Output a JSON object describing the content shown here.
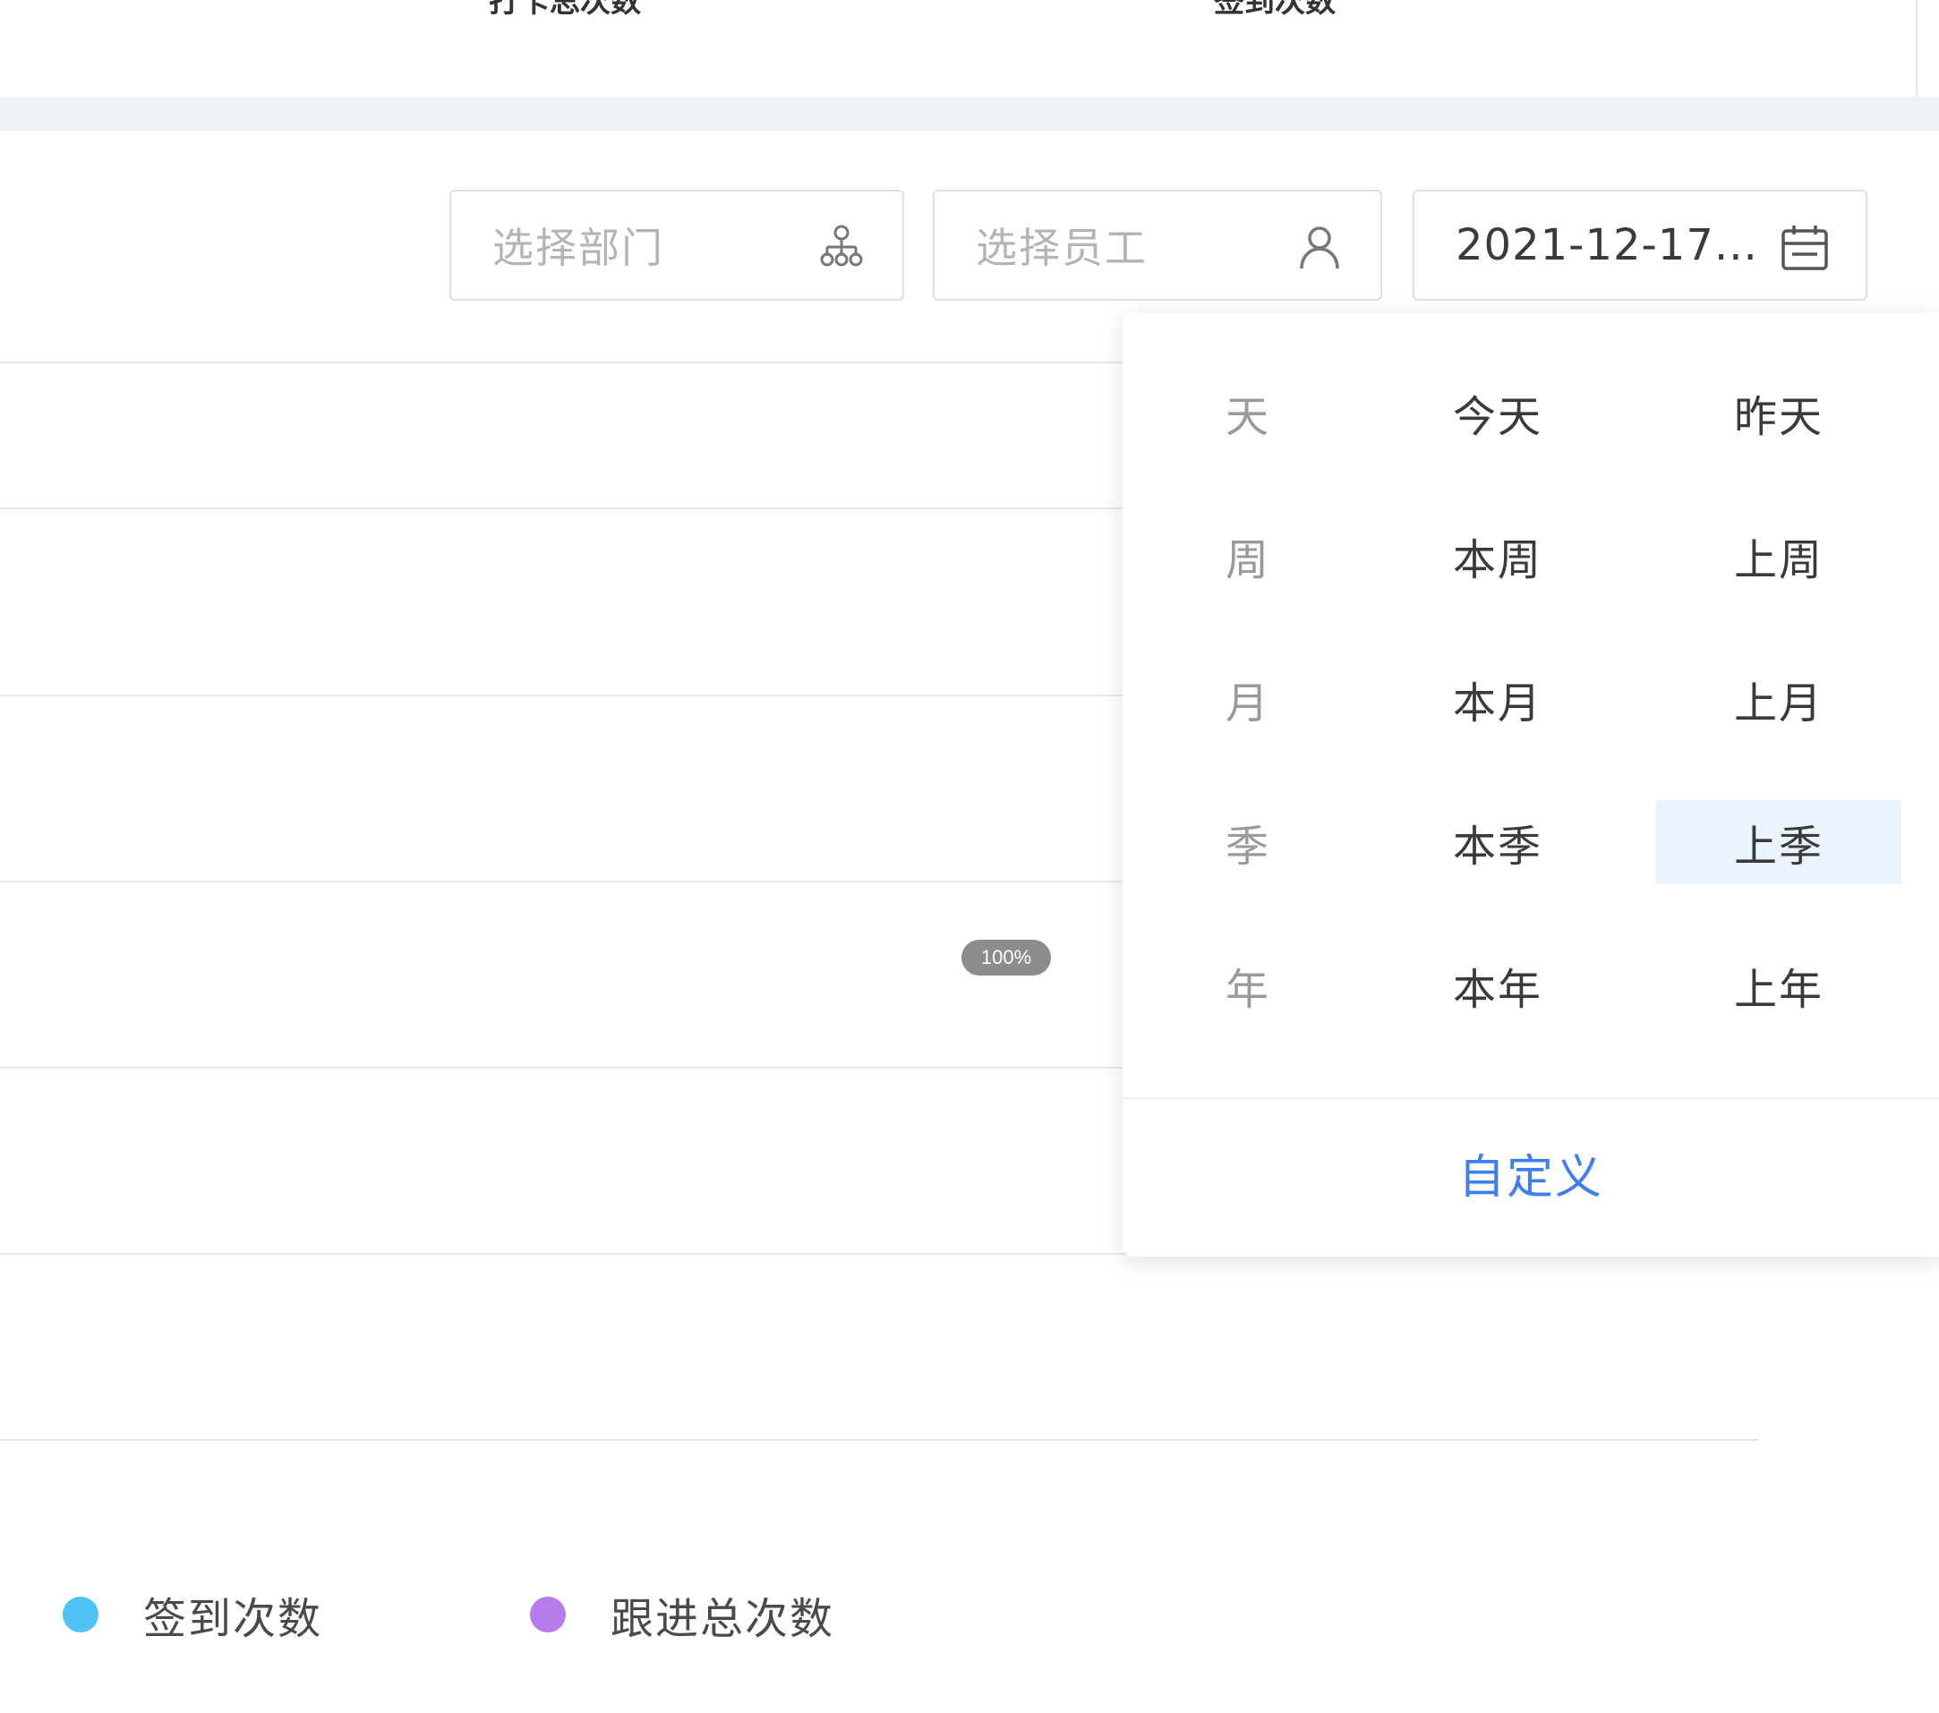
{
  "top": {
    "label_left": "打卡总次数",
    "label_right": "签到次数"
  },
  "filters": {
    "department": {
      "placeholder": "选择部门",
      "icon": "org-chart-icon"
    },
    "employee": {
      "placeholder": "选择员工",
      "icon": "user-icon"
    },
    "date": {
      "value": "2021-12-17...",
      "icon": "calendar-icon"
    }
  },
  "zoom": "100%",
  "legend": [
    {
      "label": "签到次数",
      "color": "#4fc3f7"
    },
    {
      "label": "跟进总次数",
      "color": "#b57be8"
    }
  ],
  "date_dropdown": {
    "rows": [
      {
        "head": "天",
        "options": [
          "今天",
          "昨天"
        ]
      },
      {
        "head": "周",
        "options": [
          "本周",
          "上周"
        ]
      },
      {
        "head": "月",
        "options": [
          "本月",
          "上月"
        ]
      },
      {
        "head": "季",
        "options": [
          "本季",
          "上季"
        ]
      },
      {
        "head": "年",
        "options": [
          "本年",
          "上年"
        ]
      }
    ],
    "selected": "上季",
    "custom_label": "自定义"
  },
  "colors": {
    "accent": "#3d7ff0",
    "selected_bg": "#eaf3fe",
    "band": "#eef2f5"
  }
}
